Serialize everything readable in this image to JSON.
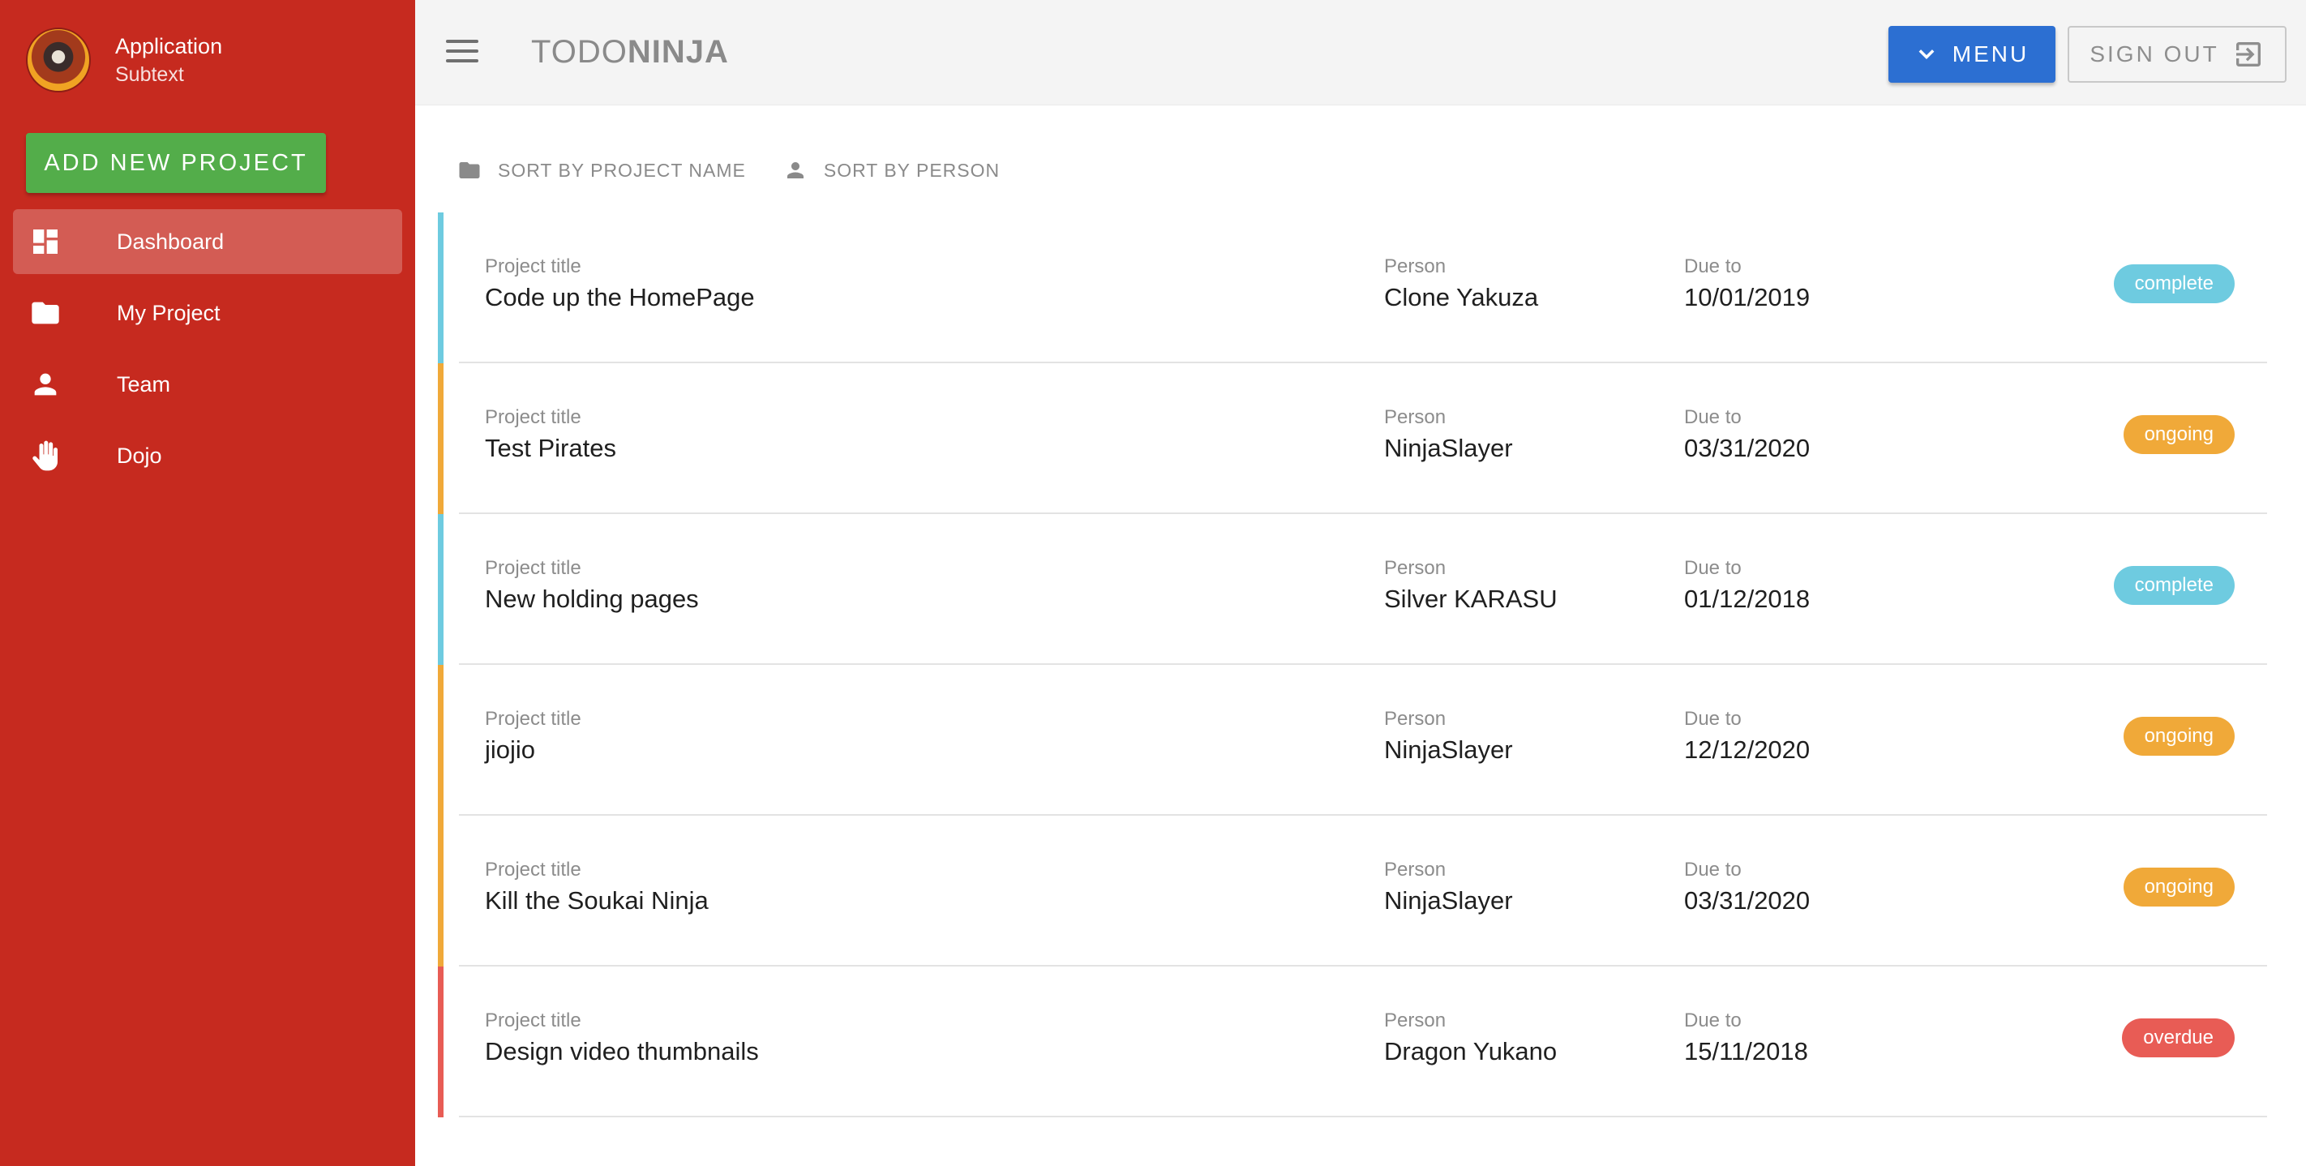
{
  "sidebar": {
    "profile": {
      "name": "Application",
      "subtext": "Subtext"
    },
    "add_button": "ADD NEW PROJECT",
    "items": [
      {
        "label": "Dashboard",
        "icon": "dashboard-icon",
        "active": true
      },
      {
        "label": "My Project",
        "icon": "folder-icon",
        "active": false
      },
      {
        "label": "Team",
        "icon": "person-icon",
        "active": false
      },
      {
        "label": "Dojo",
        "icon": "hand-icon",
        "active": false
      }
    ]
  },
  "header": {
    "brand_light": "TODO",
    "brand_bold": "NINJA",
    "menu_label": "MENU",
    "signout_label": "SIGN OUT"
  },
  "sort": {
    "by_project": "SORT BY PROJECT NAME",
    "by_person": "SORT BY PERSON"
  },
  "labels": {
    "title": "Project title",
    "person": "Person",
    "due": "Due to"
  },
  "projects": [
    {
      "title": "Code up the HomePage",
      "person": "Clone Yakuza",
      "due": "10/01/2019",
      "status": "complete"
    },
    {
      "title": "Test Pirates",
      "person": "NinjaSlayer",
      "due": "03/31/2020",
      "status": "ongoing"
    },
    {
      "title": "New holding pages",
      "person": "Silver KARASU",
      "due": "01/12/2018",
      "status": "complete"
    },
    {
      "title": "jiojio",
      "person": "NinjaSlayer",
      "due": "12/12/2020",
      "status": "ongoing"
    },
    {
      "title": "Kill the Soukai Ninja",
      "person": "NinjaSlayer",
      "due": "03/31/2020",
      "status": "ongoing"
    },
    {
      "title": "Design video thumbnails",
      "person": "Dragon Yukano",
      "due": "15/11/2018",
      "status": "overdue"
    }
  ],
  "colors": {
    "sidebar": "#c62a1f",
    "add_button": "#53ad4a",
    "menu_button": "#2c6fd2",
    "complete": "#6ecbe0",
    "ongoing": "#f0a939",
    "overdue": "#e85c55"
  }
}
